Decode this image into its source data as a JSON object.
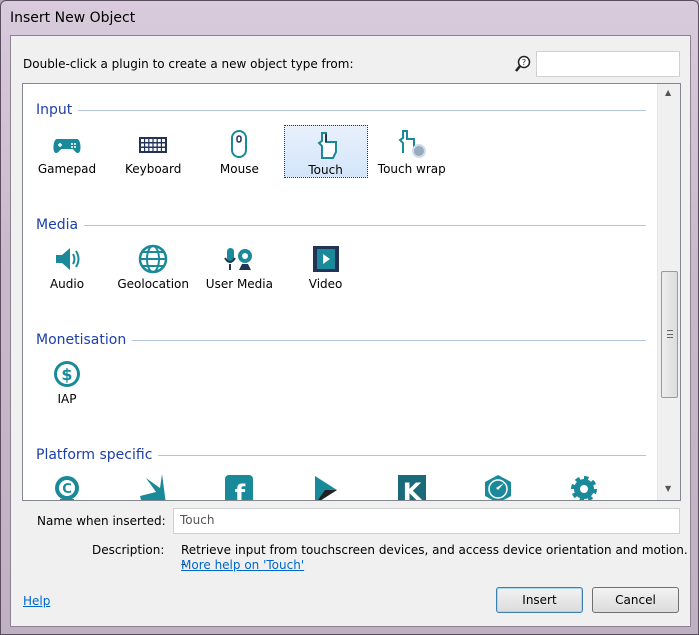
{
  "window": {
    "title": "Insert New Object"
  },
  "prompt": "Double-click a plugin to create a new object type from:",
  "search": {
    "value": "",
    "icon": "search-help-icon"
  },
  "accent_color": "#1a8a9a",
  "sections": [
    {
      "title": "Input",
      "items": [
        {
          "label": "Gamepad",
          "icon": "gamepad"
        },
        {
          "label": "Keyboard",
          "icon": "keyboard"
        },
        {
          "label": "Mouse",
          "icon": "mouse"
        },
        {
          "label": "Touch",
          "icon": "touch",
          "selected": true
        },
        {
          "label": "Touch wrap",
          "icon": "touch-wrap"
        }
      ]
    },
    {
      "title": "Media",
      "items": [
        {
          "label": "Audio",
          "icon": "audio"
        },
        {
          "label": "Geolocation",
          "icon": "globe"
        },
        {
          "label": "User Media",
          "icon": "user-media"
        },
        {
          "label": "Video",
          "icon": "video"
        }
      ]
    },
    {
      "title": "Monetisation",
      "items": [
        {
          "label": "IAP",
          "icon": "dollar"
        }
      ]
    },
    {
      "title": "Platform specific",
      "items": [
        {
          "label": "",
          "icon": "cocoonjs"
        },
        {
          "label": "",
          "icon": "burst"
        },
        {
          "label": "",
          "icon": "facebook"
        },
        {
          "label": "",
          "icon": "play"
        },
        {
          "label": "",
          "icon": "kongregate"
        },
        {
          "label": "",
          "icon": "compass"
        },
        {
          "label": "",
          "icon": "gear"
        }
      ]
    }
  ],
  "name_field": {
    "label": "Name when inserted:",
    "value": "Touch"
  },
  "description": {
    "label": "Description:",
    "text": "Retrieve input from touchscreen devices, and access device orientation and motion. -",
    "link": "More help on 'Touch'"
  },
  "footer": {
    "help": "Help",
    "insert": "Insert",
    "cancel": "Cancel"
  }
}
